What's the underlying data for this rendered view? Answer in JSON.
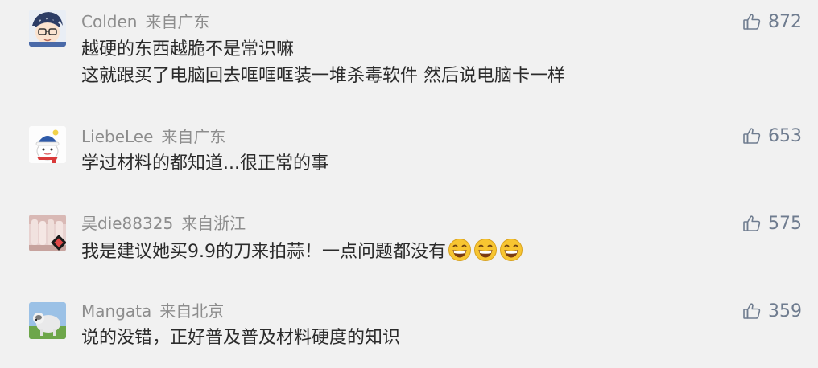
{
  "comments": [
    {
      "username": "Colden",
      "region": "来自广东",
      "likes": "872",
      "lines": [
        "越硬的东西越脆不是常识嘛",
        "这就跟买了电脑回去哐哐哐装一堆杀毒软件 然后说电脑卡一样"
      ],
      "emoji_count": 0,
      "avatar": "anime-boy-avatar"
    },
    {
      "username": "LiebeLee",
      "region": "来自广东",
      "likes": "653",
      "lines": [
        "学过材料的都知道...很正常的事"
      ],
      "emoji_count": 0,
      "avatar": "snowman-avatar"
    },
    {
      "username": "昊die88325",
      "region": "来自浙江",
      "likes": "575",
      "lines": [
        "我是建议她买9.9的刀来拍蒜！一点问题都没有"
      ],
      "emoji_count": 3,
      "avatar": "photo-avatar"
    },
    {
      "username": "Mangata",
      "region": "来自北京",
      "likes": "359",
      "lines": [
        "说的没错，正好普及普及材料硬度的知识"
      ],
      "emoji_count": 0,
      "avatar": "sheepdog-avatar"
    }
  ],
  "icons": {
    "like": "thumbs-up-icon",
    "emoji": "grinning-face-emoji"
  },
  "colors": {
    "background": "#f1f1f1",
    "meta_text": "#8d8d8d",
    "body_text": "#2b2b2b",
    "like_color": "#6f7c8f"
  }
}
